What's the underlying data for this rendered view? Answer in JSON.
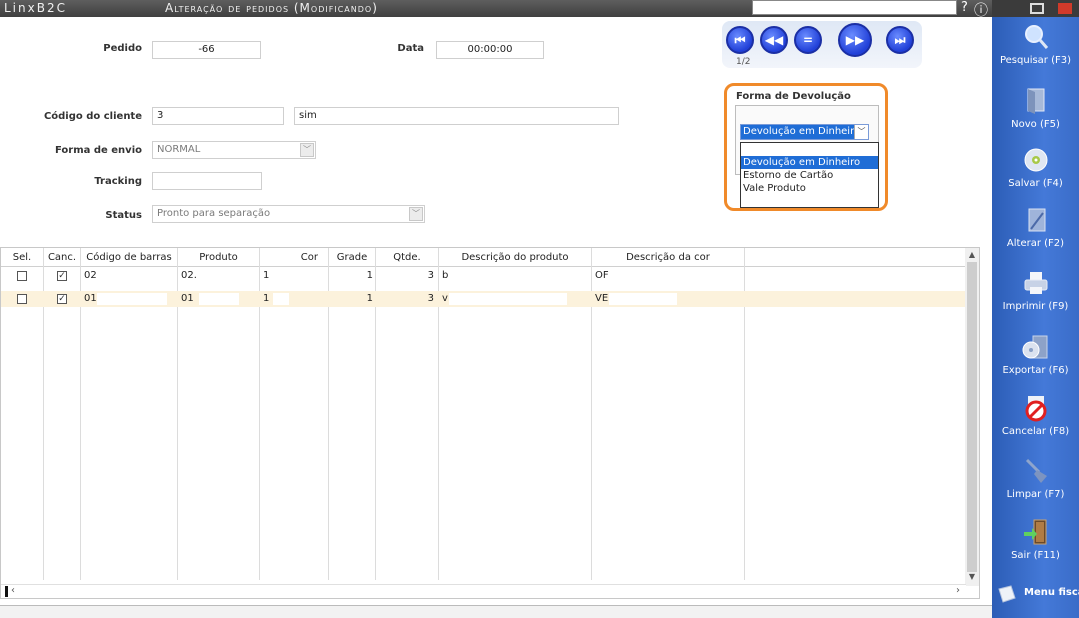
{
  "titlebar": {
    "app_name": "LinxB2C",
    "title": "Alteração de pedidos (Modificando)",
    "help_label": "?",
    "info_label": "ⓘ"
  },
  "form": {
    "pedido_label": "Pedido",
    "pedido_value": "-66",
    "data_label": "Data",
    "data_value": "00:00:00",
    "codigo_cliente_label": "Código do cliente",
    "codigo_cliente_value": "3",
    "cliente_nome_value": "sim",
    "forma_envio_label": "Forma de envio",
    "forma_envio_value": "NORMAL",
    "tracking_label": "Tracking",
    "tracking_value": "",
    "status_label": "Status",
    "status_value": "Pronto para separação"
  },
  "navigation": {
    "first_label": "⏮",
    "prev_label": "◀◀",
    "current_label": "=",
    "next_label": "▶▶",
    "last_label": "⏭",
    "record_position": "1/2"
  },
  "forma_devolucao": {
    "title": "Forma de Devolução",
    "selected": "Devolução em Dinheiro",
    "options": [
      "",
      "Devolução em Dinheiro",
      "Estorno de Cartão",
      "Vale Produto"
    ]
  },
  "grid": {
    "columns": [
      "Sel.",
      "Canc.",
      "Código de barras",
      "Produto",
      "Cor",
      "Grade",
      "Qtde.",
      "Descrição do produto",
      "Descrição da cor"
    ],
    "rows": [
      {
        "sel": false,
        "canc": true,
        "codigo_barras": "02",
        "produto": "02.",
        "cor": "1",
        "grade": "1",
        "qtde": "3",
        "descricao_produto": "b",
        "descricao_cor": "OF"
      },
      {
        "sel": false,
        "canc": true,
        "codigo_barras": "01",
        "produto": "01",
        "cor": "1",
        "grade": "1",
        "qtde": "3",
        "descricao_produto": "v",
        "descricao_cor": "VE"
      }
    ]
  },
  "sidebar": {
    "items": [
      {
        "label": "Pesquisar (F3)",
        "icon": "magnifier-icon"
      },
      {
        "label": "Novo (F5)",
        "icon": "new-document-icon"
      },
      {
        "label": "Salvar (F4)",
        "icon": "disk-icon"
      },
      {
        "label": "Alterar (F2)",
        "icon": "pencil-icon"
      },
      {
        "label": "Imprimir (F9)",
        "icon": "printer-icon"
      },
      {
        "label": "Exportar (F6)",
        "icon": "export-icon"
      },
      {
        "label": "Cancelar (F8)",
        "icon": "cancel-icon"
      },
      {
        "label": "Limpar (F7)",
        "icon": "broom-icon"
      },
      {
        "label": "Sair (F11)",
        "icon": "exit-door-icon"
      }
    ],
    "menu_fiscal_label": "Menu fiscal"
  },
  "colors": {
    "sidebar_blue": "#3a6cc8",
    "highlight_orange": "#f08a2a",
    "selection_blue": "#1f6dd6",
    "row_alt": "#fcf2dc"
  }
}
